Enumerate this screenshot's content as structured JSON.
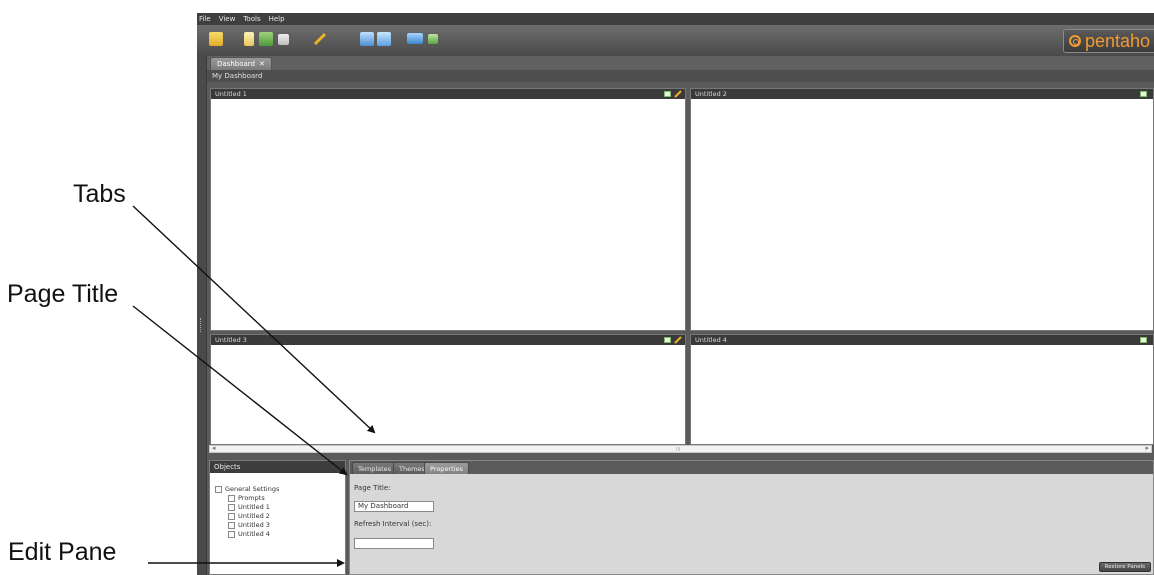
{
  "annotations": {
    "tabs": "Tabs",
    "page_title": "Page Title",
    "edit_pane": "Edit Pane"
  },
  "menu": [
    "File",
    "View",
    "Tools",
    "Help"
  ],
  "logo": {
    "text": "pentaho",
    "color": "#f29a32"
  },
  "dashboard_tab": {
    "label": "Dashboard",
    "close": "✕"
  },
  "dashboard_title": "My Dashboard",
  "panels": [
    {
      "title": "Untitled 1"
    },
    {
      "title": "Untitled 2"
    },
    {
      "title": "Untitled 3"
    },
    {
      "title": "Untitled 4"
    }
  ],
  "scrollbar": {
    "left_arrow": "◂",
    "right_arrow": "▸",
    "thumb": "III"
  },
  "objects": {
    "header": "Objects",
    "items": [
      "General Settings",
      "Prompts",
      "Untitled 1",
      "Untitled 2",
      "Untitled 3",
      "Untitled 4"
    ]
  },
  "edit_tabs": [
    "Templates",
    "Themes",
    "Properties"
  ],
  "properties": {
    "page_title_label": "Page Title:",
    "page_title_value": "My Dashboard",
    "refresh_label": "Refresh Interval (sec):",
    "refresh_value": ""
  },
  "restore_button": "Restore Panels"
}
